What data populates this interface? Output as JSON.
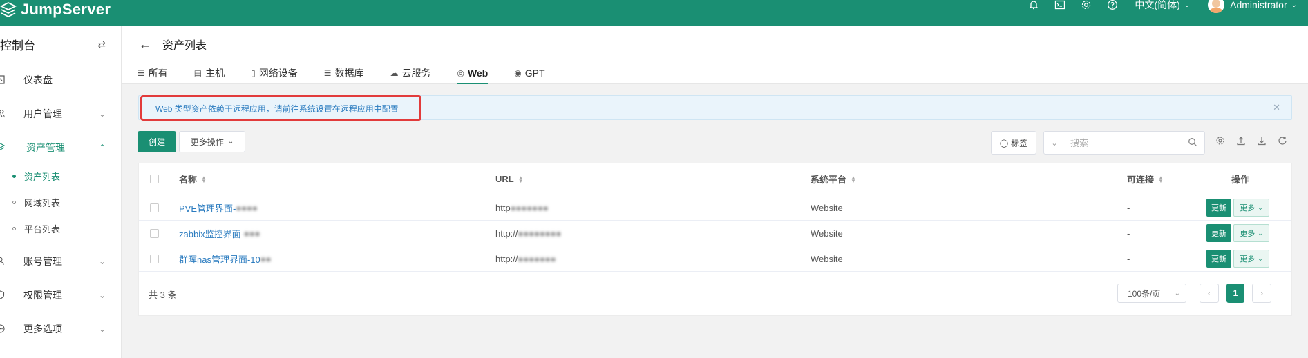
{
  "brand": {
    "name": "JumpServer",
    "color": "#1a8f73"
  },
  "topbar": {
    "icons": [
      "bell-icon",
      "terminal-icon",
      "settings-icon",
      "help-icon"
    ],
    "language": "中文(简体)",
    "user": "Administrator"
  },
  "sidebar": {
    "title": "控制台",
    "items": [
      {
        "label": "仪表盘",
        "icon": "dashboard-icon"
      },
      {
        "label": "用户管理",
        "icon": "users-icon"
      },
      {
        "label": "资产管理",
        "icon": "layers-icon",
        "expanded": true
      },
      {
        "label": "账号管理",
        "icon": "account-icon"
      },
      {
        "label": "权限管理",
        "icon": "permission-icon"
      },
      {
        "label": "更多选项",
        "icon": "more-icon"
      }
    ],
    "subitems": [
      {
        "label": "资产列表",
        "active": true
      },
      {
        "label": "网域列表"
      },
      {
        "label": "平台列表"
      }
    ]
  },
  "page": {
    "title": "资产列表",
    "tabs": [
      {
        "label": "所有",
        "icon": "list-icon"
      },
      {
        "label": "主机",
        "icon": "host-icon"
      },
      {
        "label": "网络设备",
        "icon": "network-device-icon"
      },
      {
        "label": "数据库",
        "icon": "database-icon"
      },
      {
        "label": "云服务",
        "icon": "cloud-icon"
      },
      {
        "label": "Web",
        "icon": "globe-icon",
        "active": true
      },
      {
        "label": "GPT",
        "icon": "chat-icon"
      }
    ]
  },
  "alert": {
    "text": "Web 类型资产依赖于远程应用，请前往系统设置在远程应用中配置"
  },
  "toolbar": {
    "create_label": "创建",
    "more_actions_label": "更多操作",
    "tags_label": "标签",
    "search_placeholder": "搜索"
  },
  "table": {
    "columns": [
      "名称",
      "URL",
      "系统平台",
      "可连接",
      "操作"
    ],
    "rows": [
      {
        "name": "PVE管理界面-",
        "url": "http",
        "platform": "Website",
        "connectable": "-"
      },
      {
        "name": "zabbix监控界面-",
        "url": "http://",
        "platform": "Website",
        "connectable": "-"
      },
      {
        "name": "群晖nas管理界面-10",
        "url": "http://",
        "platform": "Website",
        "connectable": "-"
      }
    ],
    "update_label": "更新",
    "more_label": "更多",
    "total": "共 3 条",
    "page_size": "100条/页",
    "current_page": "1"
  }
}
